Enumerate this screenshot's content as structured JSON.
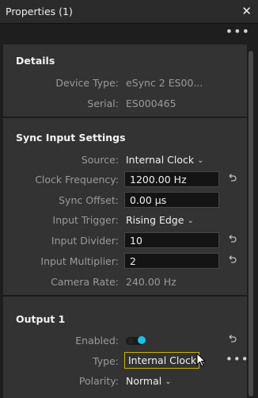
{
  "window": {
    "title": "Properties (1)",
    "close_icon": "close-icon",
    "more_icon": "ellipsis-icon"
  },
  "details": {
    "title": "Details",
    "device_type_label": "Device Type:",
    "device_type_value": "eSync 2 ES00...",
    "serial_label": "Serial:",
    "serial_value": "ES000465"
  },
  "sync": {
    "title": "Sync Input Settings",
    "source_label": "Source:",
    "source_value": "Internal Clock",
    "clock_frequency_label": "Clock Frequency:",
    "clock_frequency_value": "1200.00 Hz",
    "sync_offset_label": "Sync Offset:",
    "sync_offset_value": "0.00 µs",
    "input_trigger_label": "Input Trigger:",
    "input_trigger_value": "Rising Edge",
    "input_divider_label": "Input Divider:",
    "input_divider_value": "10",
    "input_multiplier_label": "Input Multiplier:",
    "input_multiplier_value": "2",
    "camera_rate_label": "Camera Rate:",
    "camera_rate_value": "240.00 Hz"
  },
  "output1": {
    "title": "Output 1",
    "enabled_label": "Enabled:",
    "enabled_value": true,
    "type_label": "Type:",
    "type_value": "Internal Clock",
    "polarity_label": "Polarity:",
    "polarity_value": "Normal"
  },
  "colors": {
    "toggle_on": "#19c3e6",
    "focus_border": "#c8b400"
  }
}
